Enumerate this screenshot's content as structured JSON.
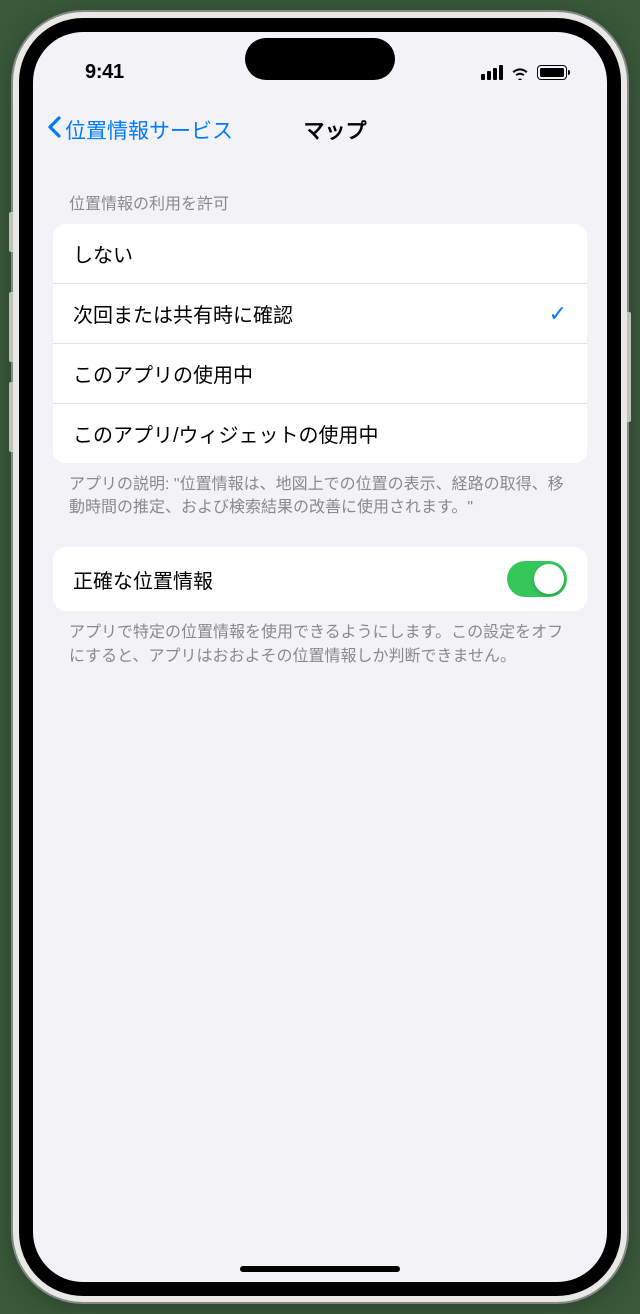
{
  "status": {
    "time": "9:41"
  },
  "nav": {
    "back_label": "位置情報サービス",
    "title": "マップ"
  },
  "permission": {
    "header": "位置情報の利用を許可",
    "options": [
      {
        "label": "しない",
        "selected": false
      },
      {
        "label": "次回または共有時に確認",
        "selected": true
      },
      {
        "label": "このアプリの使用中",
        "selected": false
      },
      {
        "label": "このアプリ/ウィジェットの使用中",
        "selected": false
      }
    ],
    "footer": "アプリの説明: \"位置情報は、地図上での位置の表示、経路の取得、移動時間の推定、および検索結果の改善に使用されます。\""
  },
  "precise": {
    "label": "正確な位置情報",
    "enabled": true,
    "footer": "アプリで特定の位置情報を使用できるようにします。この設定をオフにすると、アプリはおおよその位置情報しか判断できません。"
  }
}
